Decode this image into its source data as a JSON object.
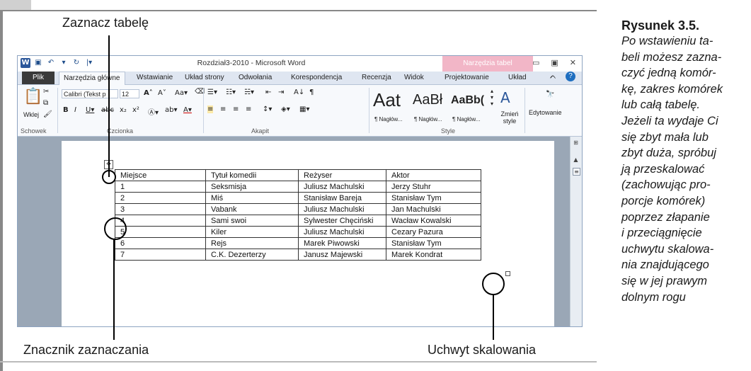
{
  "annotations": {
    "top_label": "Zaznacz tabelę",
    "bottom_left_label": "Znacznik zaznaczania",
    "bottom_right_label": "Uchwyt skalowania"
  },
  "caption": {
    "title": "Rysunek 3.5.",
    "lines": [
      "Po wstawieniu ta-",
      "beli możesz zazna-",
      "czyć jedną komór-",
      "kę, zakres komórek",
      "lub całą tabelę.",
      "Jeżeli ta wydaje Ci",
      "się zbyt mała lub",
      "zbyt duża, spróbuj",
      "ją przeskalować",
      "(zachowując pro-",
      "porcje komórek)",
      "poprzez złapanie",
      "i przeciągnięcie",
      "uchwytu skalowa-",
      "nia znajdującego",
      "się w jej prawym",
      "dolnym rogu"
    ]
  },
  "word": {
    "window_title": "Rozdział3-2010 - Microsoft Word",
    "context_tab": "Narzędzia tabel",
    "tabs": {
      "file": "Plik",
      "home": "Narzędzia główne",
      "insert": "Wstawianie",
      "page_layout": "Układ strony",
      "references": "Odwołania",
      "mailings": "Korespondencja",
      "review": "Recenzja",
      "view": "Widok",
      "design": "Projektowanie",
      "layout": "Układ"
    },
    "ribbon": {
      "paste_label": "Wklej",
      "clipboard_group": "Schowek",
      "font_name": "Calibri (Tekst p",
      "font_size": "12",
      "font_group": "Czcionka",
      "paragraph_group": "Akapit",
      "style_group": "Style",
      "style_samples": [
        "Aat",
        "AaBł",
        "AaBb("
      ],
      "style_names": [
        "¶ Nagłów...",
        "¶ Nagłów...",
        "¶ Nagłów..."
      ],
      "change_styles": "Zmień style",
      "editing": "Edytowanie"
    },
    "table": {
      "headers": [
        "Miejsce",
        "Tytuł komedii",
        "Reżyser",
        "Aktor"
      ],
      "rows": [
        [
          "1",
          "Seksmisja",
          "Juliusz Machulski",
          "Jerzy Stuhr"
        ],
        [
          "2",
          "Miś",
          "Stanisław Bareja",
          "Stanisław Tym"
        ],
        [
          "3",
          "Vabank",
          "Juliusz Machulski",
          "Jan Machulski"
        ],
        [
          "4",
          "Sami swoi",
          "Sylwester Chęciński",
          "Wacław Kowalski"
        ],
        [
          "5",
          "Kiler",
          "Juliusz Machulski",
          "Cezary Pazura"
        ],
        [
          "6",
          "Rejs",
          "Marek Piwowski",
          "Stanisław Tym"
        ],
        [
          "7",
          "C.K. Dezerterzy",
          "Janusz Majewski",
          "Marek Kondrat"
        ]
      ]
    }
  },
  "colors": {
    "file_tab": "#3a3a3a",
    "context_tab": "#f2b6c7",
    "ribbon": "#f7f9fc",
    "doc_background": "#9aa7b6"
  }
}
